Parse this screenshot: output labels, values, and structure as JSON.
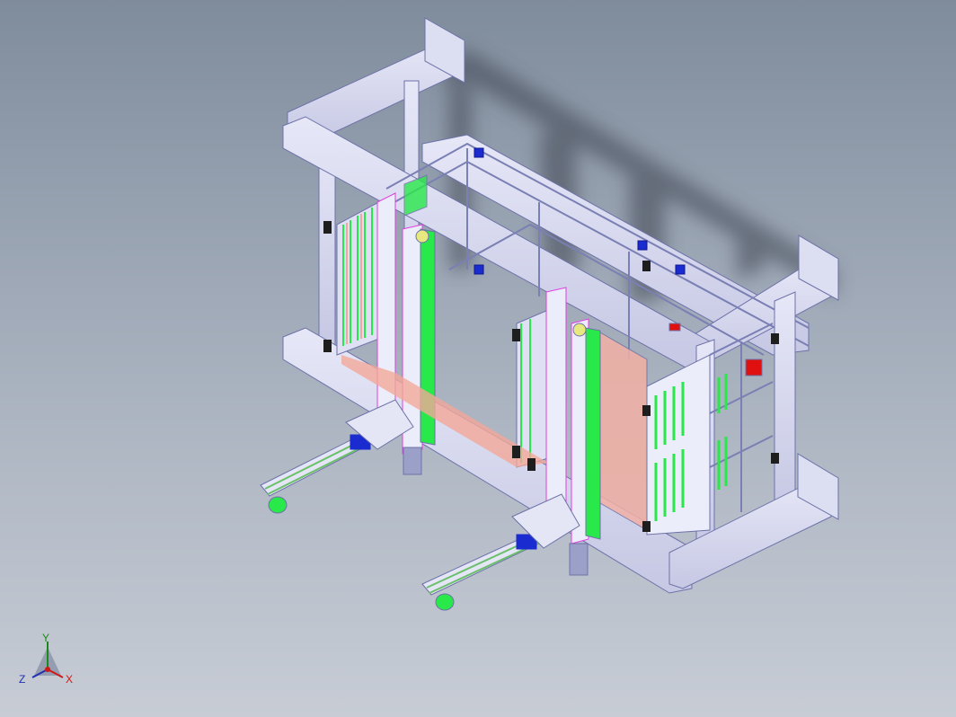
{
  "triad": {
    "x_label": "X",
    "y_label": "Y",
    "z_label": "Z"
  },
  "colors": {
    "frame": "#d6d8f0",
    "frame_edge": "#6d72a8",
    "green_part": "#29e84a",
    "pink_part": "#f2a898",
    "magenta_edge": "#e040e0",
    "blue_part": "#1a2bd0",
    "red_part": "#e01010"
  }
}
